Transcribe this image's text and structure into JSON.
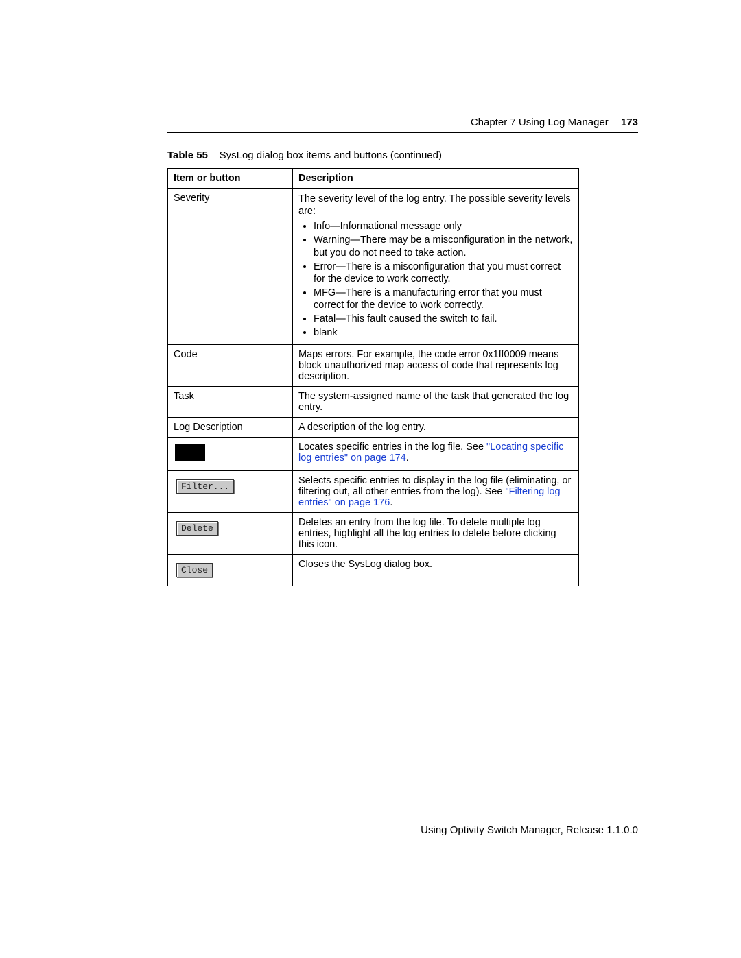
{
  "header": {
    "chapter": "Chapter 7  Using Log Manager",
    "page": "173"
  },
  "caption": {
    "label": "Table 55",
    "text": "SysLog dialog box items and buttons (continued)"
  },
  "columns": {
    "c1": "Item or button",
    "c2": "Description"
  },
  "rows": {
    "severity": {
      "item": "Severity",
      "intro": "The severity level of the log entry. The possible severity levels are:",
      "bullets": {
        "b0": "Info—Informational message only",
        "b1": "Warning—There may be a misconfiguration in the network, but you do not need to take action.",
        "b2": "Error—There is a misconfiguration that you must correct for the device to work correctly.",
        "b3": "MFG—There is a manufacturing error that you must correct for the device to work correctly.",
        "b4": "Fatal—This fault caused the switch to fail.",
        "b5": "blank"
      }
    },
    "code": {
      "item": "Code",
      "desc": "Maps errors. For example, the code error 0x1ff0009 means block unauthorized map access of code that represents log description."
    },
    "task": {
      "item": "Task",
      "desc": "The system-assigned name of the task that generated the log entry."
    },
    "logdesc": {
      "item": "Log Description",
      "desc": "A description of the log entry."
    },
    "find": {
      "desc1": "Locates specific entries in the log file. See ",
      "link": "\"Locating specific log entries\" on page 174",
      "desc2": "."
    },
    "filter": {
      "label": "Filter...",
      "desc1": "Selects specific entries to display in the log file (eliminating, or filtering out, all other entries from the log). See ",
      "link": "\"Filtering log entries\" on page 176",
      "desc2": "."
    },
    "delete": {
      "label": "Delete",
      "desc": "Deletes an entry from the log file. To delete multiple log entries, highlight all the log entries to delete before clicking this icon."
    },
    "close": {
      "label": "Close",
      "desc": "Closes the SysLog dialog box."
    }
  },
  "footer": "Using Optivity Switch Manager, Release 1.1.0.0"
}
